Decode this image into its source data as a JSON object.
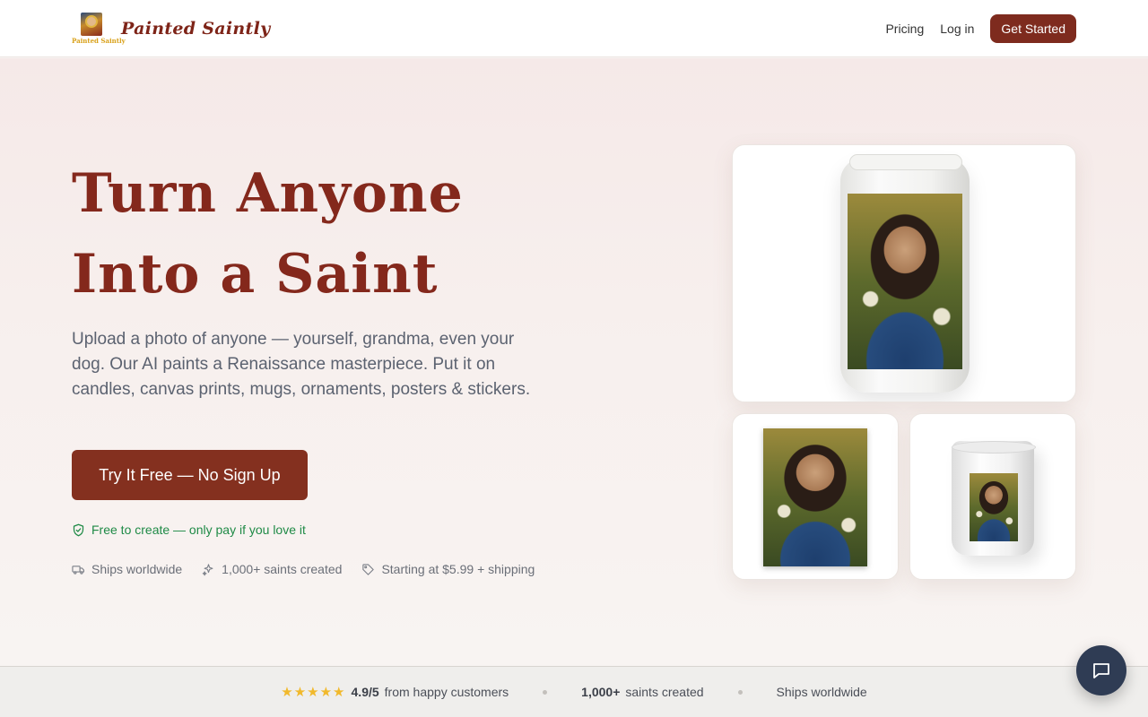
{
  "nav": {
    "brand_name": "Painted Saintly",
    "brand_logo_text": "Painted Saintly",
    "links": [
      {
        "label": "Pricing"
      },
      {
        "label": "Log in"
      }
    ],
    "cta_label": "Get Started"
  },
  "hero": {
    "title": "Turn Anyone Into a Saint",
    "subtitle": "Upload a photo of anyone — yourself, grandma, even your dog. Our AI paints a Renaissance masterpiece. Put it on candles, canvas prints, mugs, ornaments, posters & stickers.",
    "cta_label": "Try It Free — No Sign Up",
    "free_note": "Free to create — only pay if you love it",
    "features": [
      {
        "icon": "truck-icon",
        "label": "Ships worldwide"
      },
      {
        "icon": "sparkles-icon",
        "label": "1,000+ saints created"
      },
      {
        "icon": "tag-icon",
        "label": "Starting at $5.99 + shipping"
      }
    ]
  },
  "products": [
    {
      "name": "candle"
    },
    {
      "name": "canvas-print"
    },
    {
      "name": "mug"
    }
  ],
  "stats_bar": {
    "stars": "★★★★★",
    "rating": "4.9/5",
    "rating_label": "from happy customers",
    "count": "1,000+",
    "count_label": "saints created",
    "shipping": "Ships worldwide"
  },
  "colors": {
    "brand": "#84281c",
    "cta": "#84301f",
    "success": "#1f8a46",
    "star": "#f1b92c",
    "chat": "#2f3c54"
  }
}
